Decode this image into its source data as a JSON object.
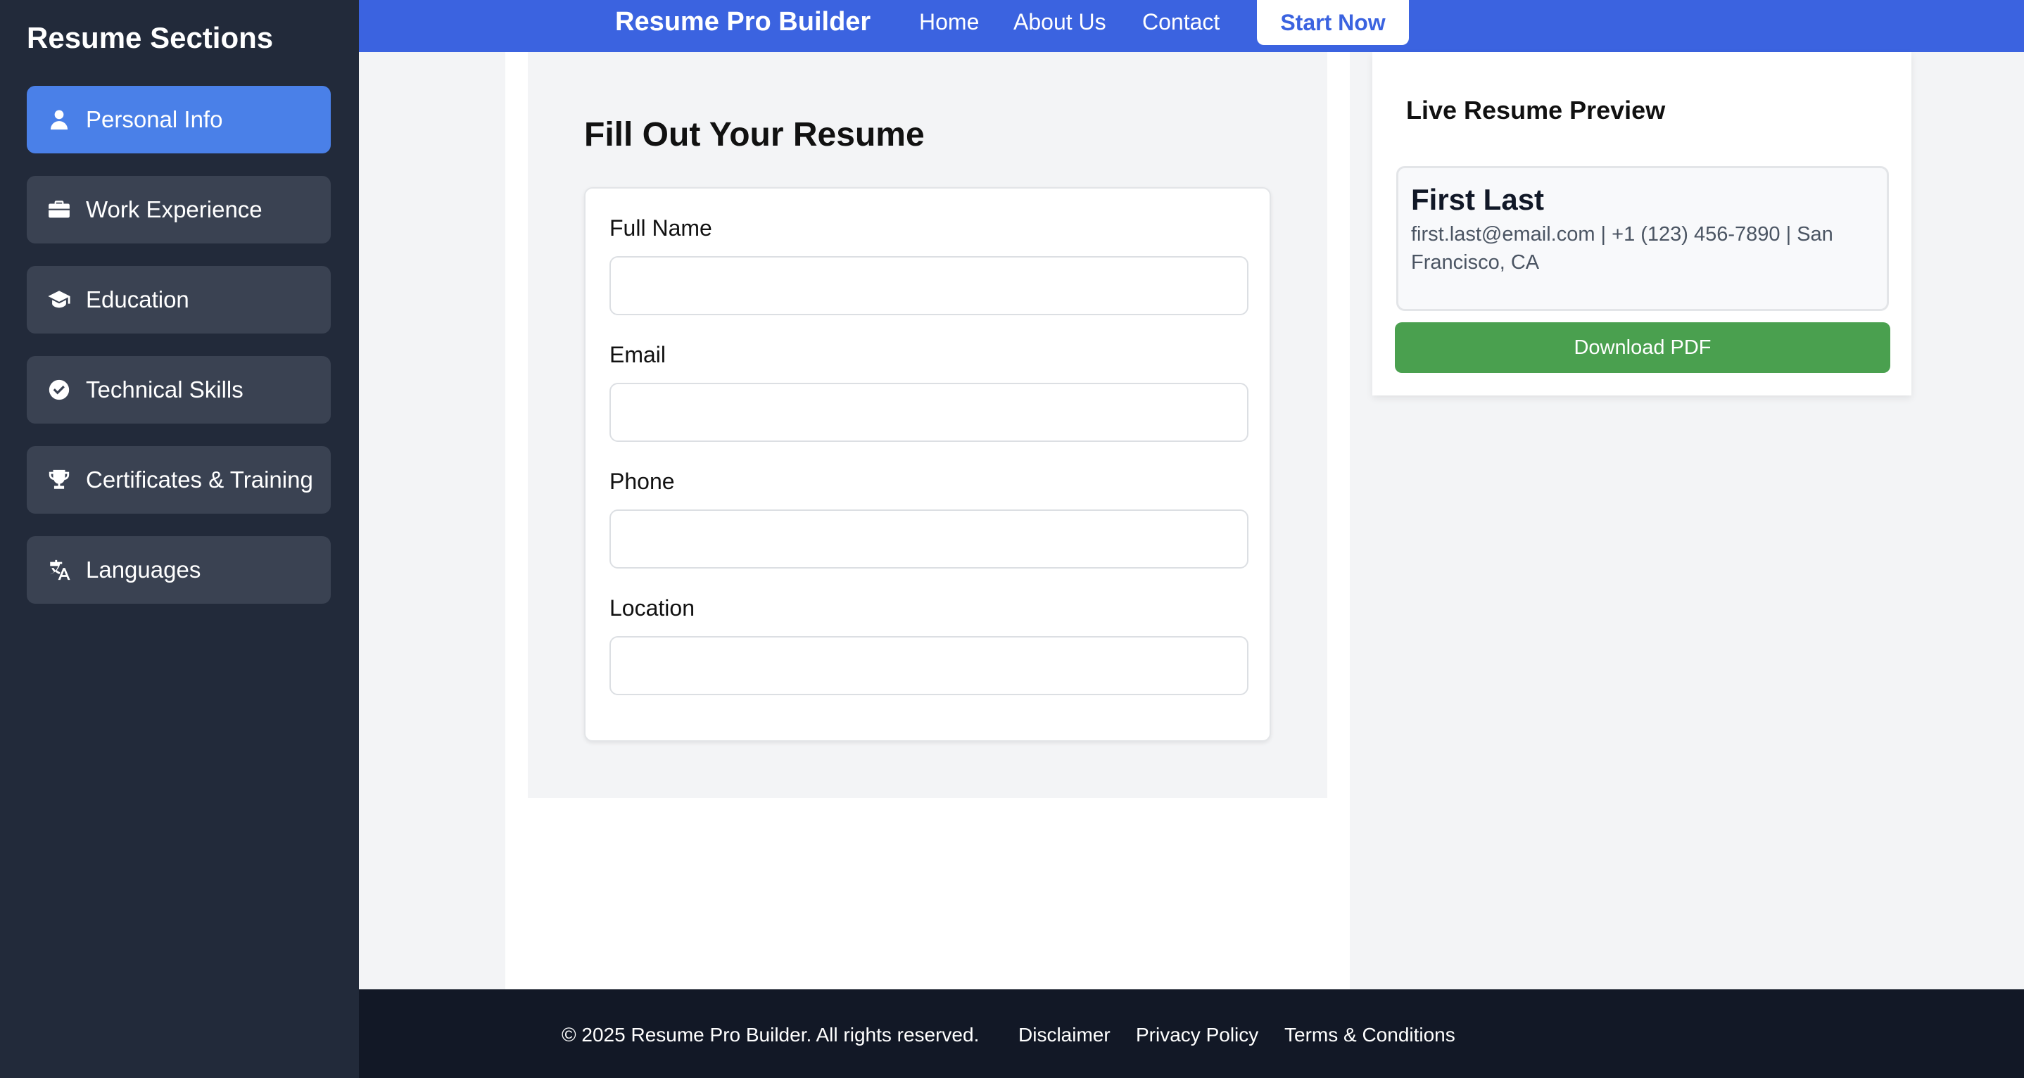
{
  "sidebar": {
    "title": "Resume Sections",
    "items": [
      {
        "label": "Personal Info",
        "icon": "user-icon",
        "active": true
      },
      {
        "label": "Work Experience",
        "icon": "briefcase-icon"
      },
      {
        "label": "Education",
        "icon": "graduation-cap-icon"
      },
      {
        "label": "Technical Skills",
        "icon": "check-circle-icon"
      },
      {
        "label": "Certificates & Training",
        "icon": "trophy-icon"
      },
      {
        "label": "Languages",
        "icon": "translate-icon"
      }
    ]
  },
  "header": {
    "brand": "Resume Pro Builder",
    "nav": [
      "Home",
      "About Us",
      "Contact"
    ],
    "cta": "Start Now"
  },
  "form": {
    "title": "Fill Out Your Resume",
    "fields": [
      {
        "label": "Full Name",
        "value": ""
      },
      {
        "label": "Email",
        "value": ""
      },
      {
        "label": "Phone",
        "value": ""
      },
      {
        "label": "Location",
        "value": ""
      }
    ]
  },
  "preview": {
    "title": "Live Resume Preview",
    "name": "First Last",
    "contact_line1": "first.last@email.com | +1 (123) 456-7890 | San",
    "contact_line2": "Francisco, CA",
    "download_label": "Download PDF"
  },
  "footer": {
    "copyright": "© 2025 Resume Pro Builder. All rights reserved.",
    "links": [
      "Disclaimer",
      "Privacy Policy",
      "Terms & Conditions"
    ]
  },
  "colors": {
    "sidebar_bg": "#222a3a",
    "sidebar_item": "#3a4252",
    "sidebar_active": "#4a80e8",
    "header_bg": "#3b63e0",
    "download_btn": "#4aa04f",
    "footer_bg": "#121826"
  }
}
